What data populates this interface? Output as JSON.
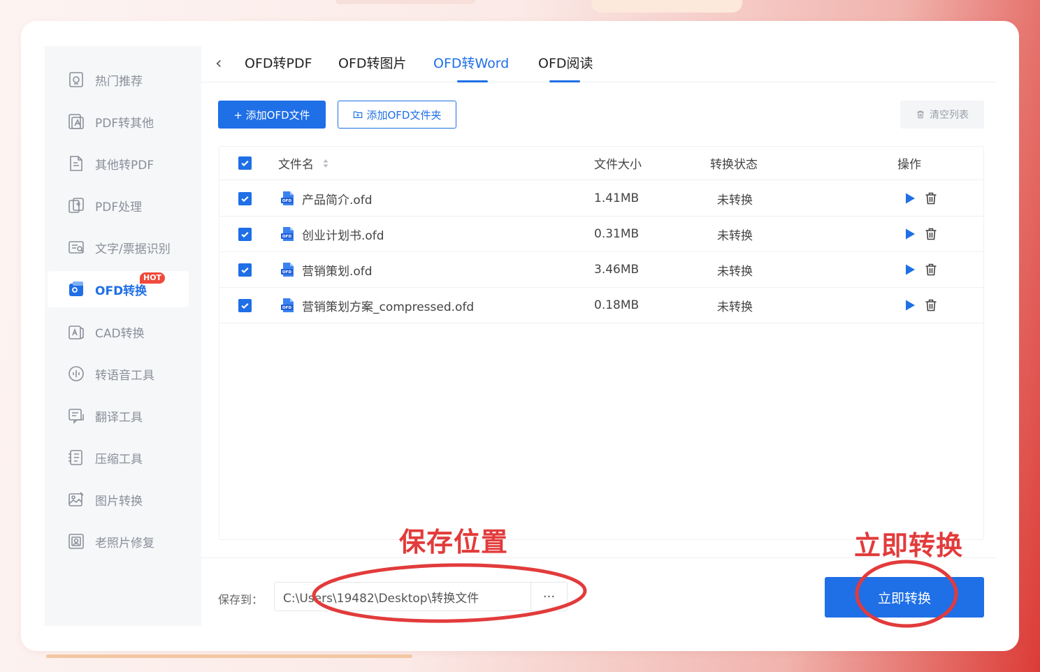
{
  "sidebar": {
    "items": [
      {
        "label": "热门推荐",
        "icon": "hot-icon"
      },
      {
        "label": "PDF转其他",
        "icon": "pdf-convert-icon"
      },
      {
        "label": "其他转PDF",
        "icon": "to-pdf-icon"
      },
      {
        "label": "PDF处理",
        "icon": "pdf-process-icon"
      },
      {
        "label": "文字/票据识别",
        "icon": "ocr-icon"
      },
      {
        "label": "OFD转换",
        "icon": "ofd-icon",
        "active": true,
        "badge": "HOT"
      },
      {
        "label": "CAD转换",
        "icon": "cad-icon"
      },
      {
        "label": "转语音工具",
        "icon": "voice-icon"
      },
      {
        "label": "翻译工具",
        "icon": "translate-icon"
      },
      {
        "label": "压缩工具",
        "icon": "compress-icon"
      },
      {
        "label": "图片转换",
        "icon": "image-icon"
      },
      {
        "label": "老照片修复",
        "icon": "photo-repair-icon"
      }
    ]
  },
  "tabs": {
    "back_icon": "chevron-left-icon",
    "items": [
      {
        "label": "OFD转PDF"
      },
      {
        "label": "OFD转图片"
      },
      {
        "label": "OFD转Word",
        "active": true
      },
      {
        "label": "OFD阅读"
      }
    ]
  },
  "toolbar": {
    "add_file_label": "+ 添加OFD文件",
    "add_folder_label": "添加OFD文件夹",
    "clear_label": "清空列表"
  },
  "table": {
    "headers": {
      "name": "文件名",
      "size": "文件大小",
      "status": "转换状态",
      "actions": "操作"
    },
    "rows": [
      {
        "name": "产品简介.ofd",
        "size": "1.41MB",
        "status": "未转换"
      },
      {
        "name": "创业计划书.ofd",
        "size": "0.31MB",
        "status": "未转换"
      },
      {
        "name": "营销策划.ofd",
        "size": "3.46MB",
        "status": "未转换"
      },
      {
        "name": "营销策划方案_compressed.ofd",
        "size": "0.18MB",
        "status": "未转换"
      }
    ],
    "file_icon_text": "OFD"
  },
  "footer": {
    "save_label": "保存到：",
    "save_path": "C:\\Users\\19482\\Desktop\\转换文件",
    "more_label": "···",
    "convert_label": "立即转换"
  },
  "annotations": {
    "save_location": "保存位置",
    "convert_now": "立即转换",
    "color": "#e23b3b"
  },
  "colors": {
    "accent": "#1f6fe6",
    "badge": "#f04a3c"
  }
}
